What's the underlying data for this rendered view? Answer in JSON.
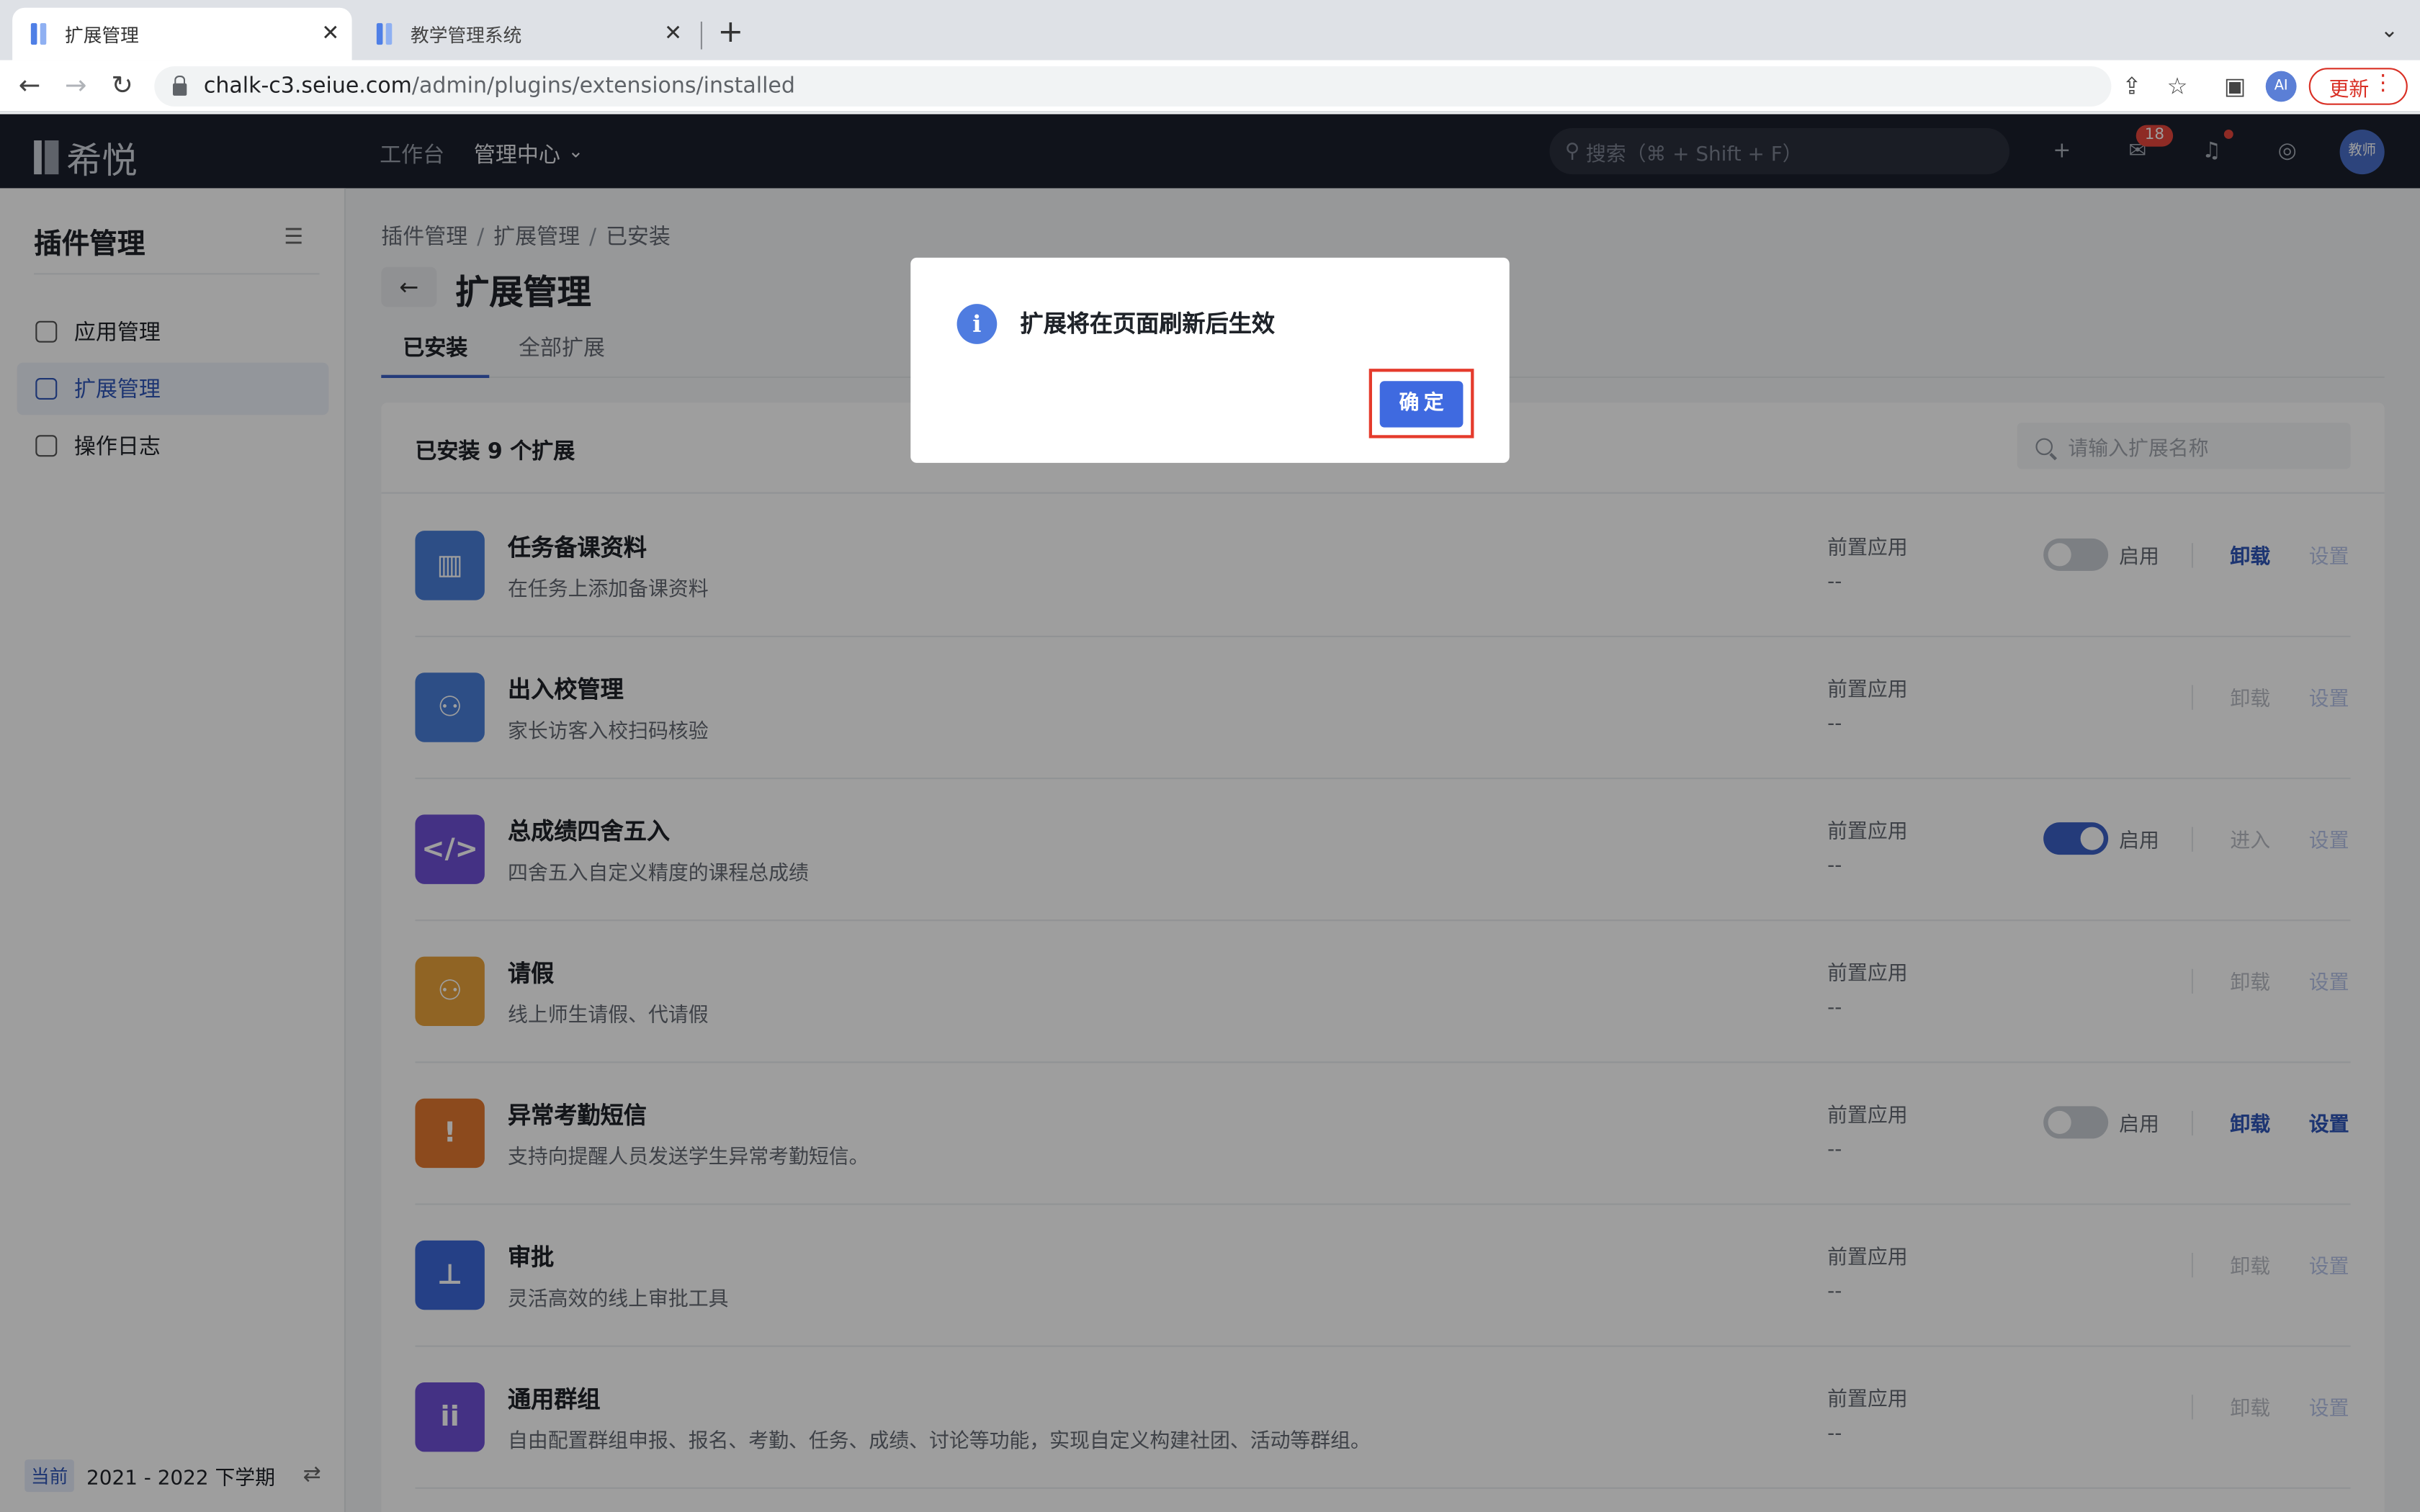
{
  "browser": {
    "tabs": [
      {
        "title": "扩展管理",
        "active": true
      },
      {
        "title": "教学管理系统",
        "active": false
      }
    ],
    "url_host": "chalk-c3.seiue.com",
    "url_path": "/admin/plugins/extensions/installed",
    "update_label": "更新",
    "ext_avatar": "AI"
  },
  "header": {
    "logo_text": "希悦",
    "nav": [
      "工作台",
      "管理中心"
    ],
    "search_placeholder": "搜索（⌘ + Shift + F）",
    "message_count": "18",
    "user_avatar_text": "教师"
  },
  "sidebar": {
    "title": "插件管理",
    "items": [
      {
        "label": "应用管理",
        "active": false
      },
      {
        "label": "扩展管理",
        "active": true
      },
      {
        "label": "操作日志",
        "active": false
      }
    ],
    "term_tag": "当前",
    "term": "2021 - 2022 下学期"
  },
  "main": {
    "breadcrumb": [
      "插件管理",
      "扩展管理",
      "已安装"
    ],
    "title": "扩展管理",
    "tabs": [
      "已安装",
      "全部扩展"
    ],
    "count_label": "已安装 9 个扩展",
    "search_placeholder": "请输入扩展名称",
    "prereq_label": "前置应用",
    "prereq_value": "--",
    "enable_label": "启用",
    "uninstall_label": "卸载",
    "enter_label": "进入",
    "settings_label": "设置",
    "extensions": [
      {
        "name": "任务备课资料",
        "desc": "在任务上添加备课资料",
        "color": "#4a7fd8",
        "icon": "book-icon"
      },
      {
        "name": "出入校管理",
        "desc": "家长访客入校扫码核验",
        "color": "#4a7fd8",
        "icon": "person-clock-icon"
      },
      {
        "name": "总成绩四舍五入",
        "desc": "四舍五入自定义精度的课程总成绩",
        "color": "#6f4fd6",
        "icon": "code-icon"
      },
      {
        "name": "请假",
        "desc": "线上师生请假、代请假",
        "color": "#e8a23a",
        "icon": "person-clock-icon"
      },
      {
        "name": "异常考勤短信",
        "desc": "支持向提醒人员发送学生异常考勤短信。",
        "color": "#e3782f",
        "icon": "alert-message-icon"
      },
      {
        "name": "审批",
        "desc": "灵活高效的线上审批工具",
        "color": "#3d68d8",
        "icon": "stamp-icon"
      },
      {
        "name": "通用群组",
        "desc": "自由配置群组申报、报名、考勤、任务、成绩、讨论等功能，实现自定义构建社团、活动等群组。",
        "color": "#6f4fd6",
        "icon": "group-icon"
      }
    ]
  },
  "dialog": {
    "message": "扩展将在页面刷新后生效",
    "ok_label": "确定"
  }
}
